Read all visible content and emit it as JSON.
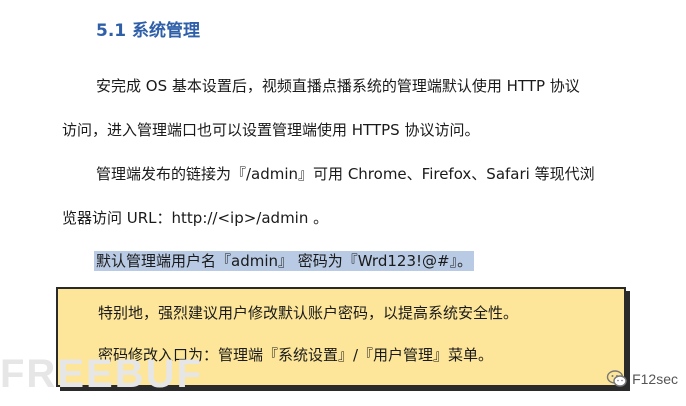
{
  "heading": "5.1 系统管理",
  "paragraphs": {
    "p1": "安完成 OS 基本设置后，视频直播点播系统的管理端默认使用 HTTP 协议",
    "p2": "访问，进入管理端口也可以设置管理端使用 HTTPS 协议访问。",
    "p3": "管理端发布的链接为『/admin』可用 Chrome、Firefox、Safari 等现代浏",
    "p4": "览器访问 URL：http://<ip>/admin 。",
    "p5": "默认管理端用户名『admin』 密码为『Wrd123!@#』。"
  },
  "note": {
    "line1": "特别地，强烈建议用户修改默认账户密码，以提高系统安全性。",
    "line2": "密码修改入口为：管理端『系统设置』/『用户管理』菜单。",
    "background_color": "#fde699"
  },
  "highlight_color": "#b9cbe4",
  "heading_color": "#2e5fa8",
  "watermarks": {
    "left": "FREEBUF",
    "right": "F12sec",
    "right_icon": "wechat-icon"
  }
}
